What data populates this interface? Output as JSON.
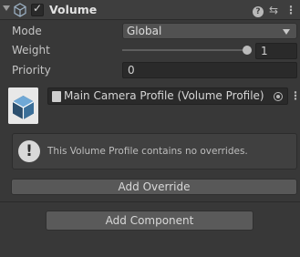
{
  "component": {
    "title": "Volume",
    "enabled_mark": "✓",
    "icon": "volume-cube-icon"
  },
  "header_icons": {
    "help": "?",
    "presets": "⇆",
    "more": "⋮"
  },
  "properties": {
    "mode": {
      "label": "Mode",
      "value": "Global"
    },
    "weight": {
      "label": "Weight",
      "value": "1",
      "slider_fraction": 1.0
    },
    "priority": {
      "label": "Priority",
      "value": "0"
    }
  },
  "profile": {
    "name": "Main Camera Profile (Volume Profile)",
    "more": "⋮"
  },
  "helpbox": {
    "icon": "!",
    "message": "This Volume Profile contains no overrides."
  },
  "buttons": {
    "add_override": "Add Override",
    "add_component": "Add Component"
  },
  "colors": {
    "background": "#383838",
    "header": "#3e3e3e",
    "field": "#2a2a2a",
    "button": "#585858",
    "text": "#c4c4c4"
  }
}
